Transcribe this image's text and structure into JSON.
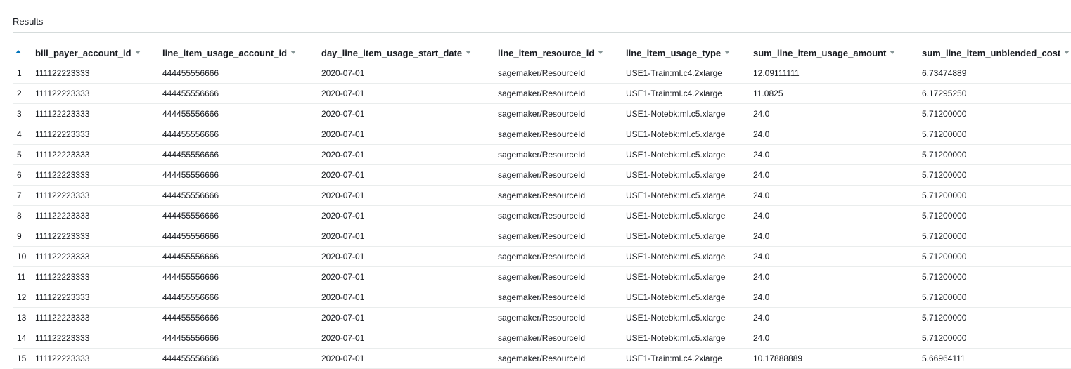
{
  "panel": {
    "title": "Results"
  },
  "table": {
    "columns": [
      "bill_payer_account_id",
      "line_item_usage_account_id",
      "day_line_item_usage_start_date",
      "line_item_resource_id",
      "line_item_usage_type",
      "sum_line_item_usage_amount",
      "sum_line_item_unblended_cost"
    ],
    "rows": [
      [
        "1",
        "111122223333",
        "444455556666",
        "2020-07-01",
        "sagemaker/ResourceId",
        "USE1-Train:ml.c4.2xlarge",
        "12.09111111",
        "6.73474889"
      ],
      [
        "2",
        "111122223333",
        "444455556666",
        "2020-07-01",
        "sagemaker/ResourceId",
        "USE1-Train:ml.c4.2xlarge",
        "11.0825",
        "6.17295250"
      ],
      [
        "3",
        "111122223333",
        "444455556666",
        "2020-07-01",
        "sagemaker/ResourceId",
        "USE1-Notebk:ml.c5.xlarge",
        "24.0",
        "5.71200000"
      ],
      [
        "4",
        "111122223333",
        "444455556666",
        "2020-07-01",
        "sagemaker/ResourceId",
        "USE1-Notebk:ml.c5.xlarge",
        "24.0",
        "5.71200000"
      ],
      [
        "5",
        "111122223333",
        "444455556666",
        "2020-07-01",
        "sagemaker/ResourceId",
        "USE1-Notebk:ml.c5.xlarge",
        "24.0",
        "5.71200000"
      ],
      [
        "6",
        "111122223333",
        "444455556666",
        "2020-07-01",
        "sagemaker/ResourceId",
        "USE1-Notebk:ml.c5.xlarge",
        "24.0",
        "5.71200000"
      ],
      [
        "7",
        "111122223333",
        "444455556666",
        "2020-07-01",
        "sagemaker/ResourceId",
        "USE1-Notebk:ml.c5.xlarge",
        "24.0",
        "5.71200000"
      ],
      [
        "8",
        "111122223333",
        "444455556666",
        "2020-07-01",
        "sagemaker/ResourceId",
        "USE1-Notebk:ml.c5.xlarge",
        "24.0",
        "5.71200000"
      ],
      [
        "9",
        "111122223333",
        "444455556666",
        "2020-07-01",
        "sagemaker/ResourceId",
        "USE1-Notebk:ml.c5.xlarge",
        "24.0",
        "5.71200000"
      ],
      [
        "10",
        "111122223333",
        "444455556666",
        "2020-07-01",
        "sagemaker/ResourceId",
        "USE1-Notebk:ml.c5.xlarge",
        "24.0",
        "5.71200000"
      ],
      [
        "11",
        "111122223333",
        "444455556666",
        "2020-07-01",
        "sagemaker/ResourceId",
        "USE1-Notebk:ml.c5.xlarge",
        "24.0",
        "5.71200000"
      ],
      [
        "12",
        "111122223333",
        "444455556666",
        "2020-07-01",
        "sagemaker/ResourceId",
        "USE1-Notebk:ml.c5.xlarge",
        "24.0",
        "5.71200000"
      ],
      [
        "13",
        "111122223333",
        "444455556666",
        "2020-07-01",
        "sagemaker/ResourceId",
        "USE1-Notebk:ml.c5.xlarge",
        "24.0",
        "5.71200000"
      ],
      [
        "14",
        "111122223333",
        "444455556666",
        "2020-07-01",
        "sagemaker/ResourceId",
        "USE1-Notebk:ml.c5.xlarge",
        "24.0",
        "5.71200000"
      ],
      [
        "15",
        "111122223333",
        "444455556666",
        "2020-07-01",
        "sagemaker/ResourceId",
        "USE1-Train:ml.c4.2xlarge",
        "10.17888889",
        "5.66964111"
      ]
    ]
  },
  "colors": {
    "sort_accent": "#0073bb",
    "caret": "#879596",
    "divider": "#d5dbdb",
    "row_border": "#eaeded",
    "text": "#16191f"
  },
  "icons": {
    "sort": "sort-ascending-icon",
    "column_menu": "caret-down-icon"
  }
}
